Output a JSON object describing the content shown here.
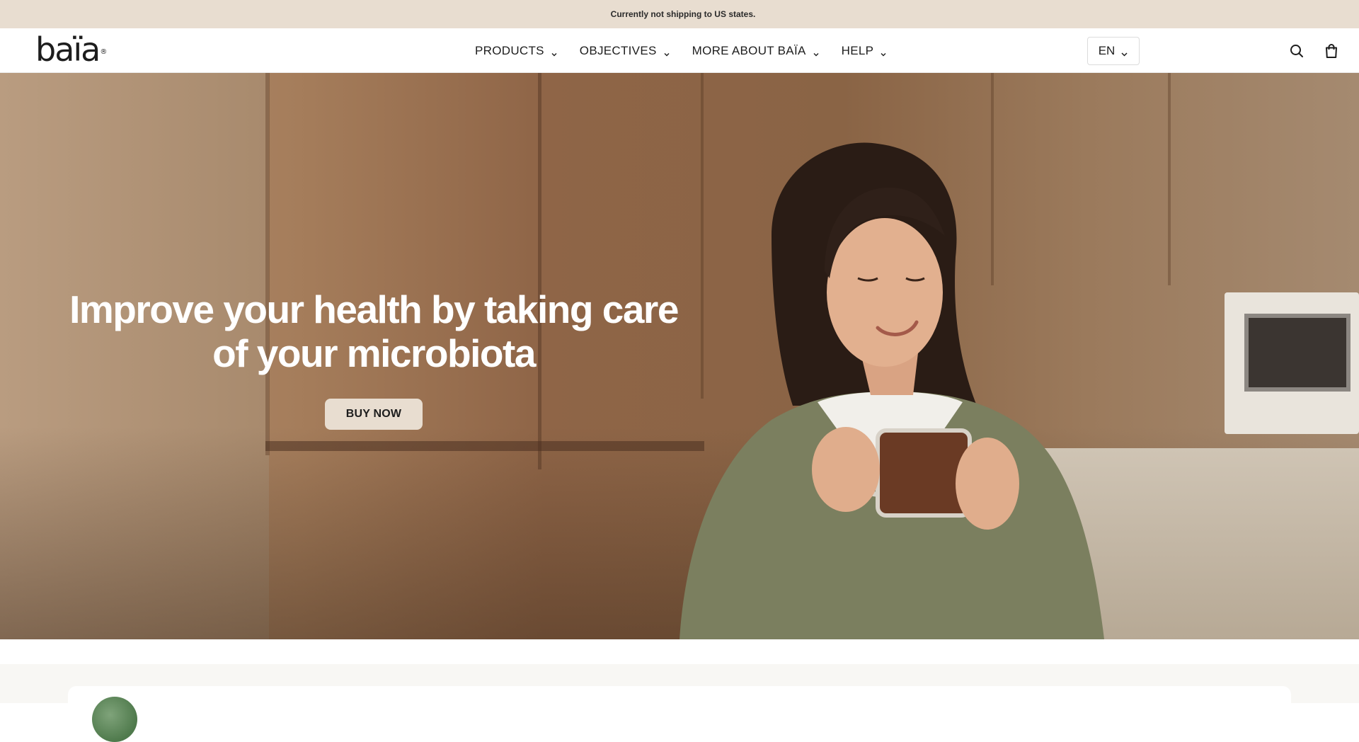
{
  "announcement": {
    "flag_icon": "us-flag-icon",
    "text": "Currently not shipping to US states."
  },
  "header": {
    "logo_text": "baïa",
    "logo_mark": "®",
    "nav": [
      {
        "label": "PRODUCTS",
        "icon": "chevron-down-icon"
      },
      {
        "label": "OBJECTIVES",
        "icon": "chevron-down-icon"
      },
      {
        "label": "MORE ABOUT BAÏA",
        "icon": "chevron-down-icon"
      },
      {
        "label": "HELP",
        "icon": "chevron-down-icon"
      }
    ],
    "language": "EN",
    "search_icon": "search-icon",
    "cart_icon": "shopping-bag-icon"
  },
  "hero": {
    "title": "Improve your health by taking care of your microbiota",
    "cta_label": "BUY NOW",
    "image_subject": "woman-with-cup-photo"
  },
  "colors": {
    "announcement_bg": "#e8ddd0",
    "cta_bg": "#e8ddd0",
    "text": "#1d1d1d",
    "below_bg": "#f8f7f4"
  }
}
